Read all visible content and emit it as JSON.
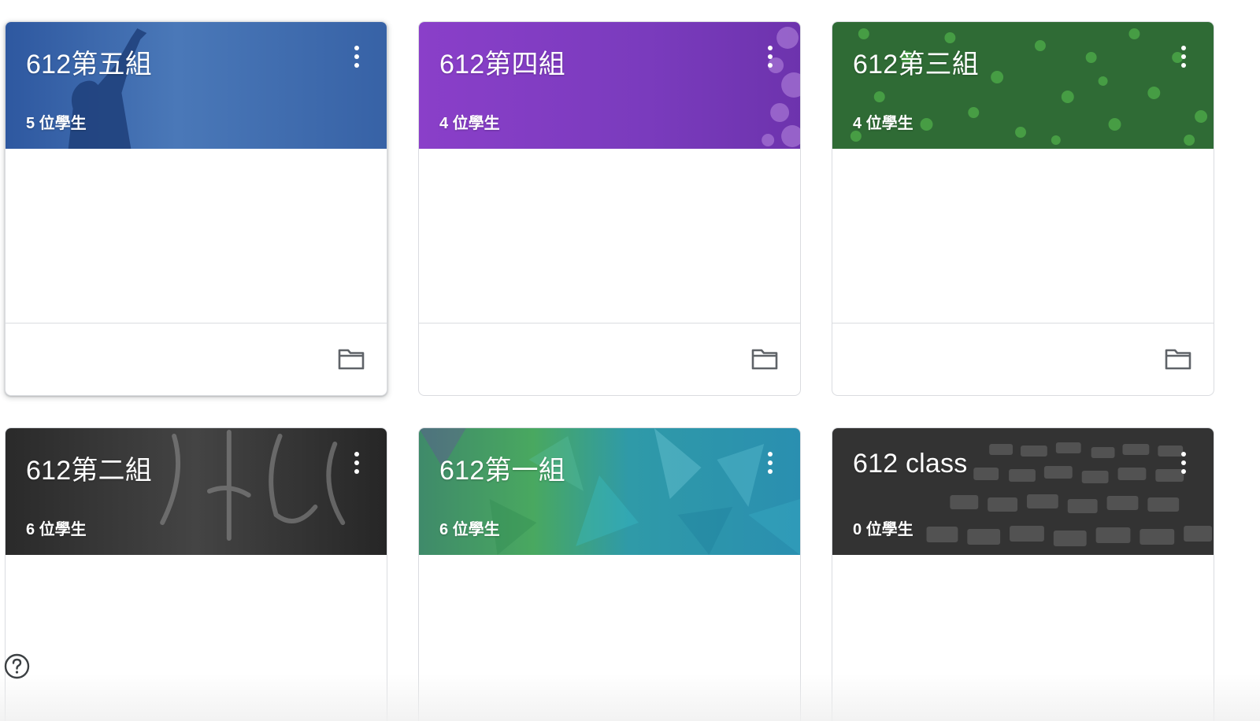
{
  "classes": [
    {
      "title": "612第五組",
      "students": "5 位學生",
      "theme": "blue-silhouette",
      "color": "#3b64a4",
      "has_footer": true
    },
    {
      "title": "612第四組",
      "students": "4 位學生",
      "theme": "purple-floral",
      "color": "#7e3fc0",
      "has_footer": true
    },
    {
      "title": "612第三組",
      "students": "4 位學生",
      "theme": "green-dots",
      "color": "#2f6b35",
      "has_footer": true
    },
    {
      "title": "612第二組",
      "students": "6 位學生",
      "theme": "dark-graffiti",
      "color": "#2f2f2f",
      "has_footer": false
    },
    {
      "title": "612第一組",
      "students": "6 位學生",
      "theme": "teal-polygons",
      "color": "#2c8fa4",
      "has_footer": false
    },
    {
      "title": "612 class",
      "students": "0 位學生",
      "theme": "cobblestone",
      "color": "#3a3a3a",
      "has_footer": false
    }
  ],
  "icons": {
    "more": "more-vert-icon",
    "folder": "folder-icon",
    "help": "help-icon"
  }
}
